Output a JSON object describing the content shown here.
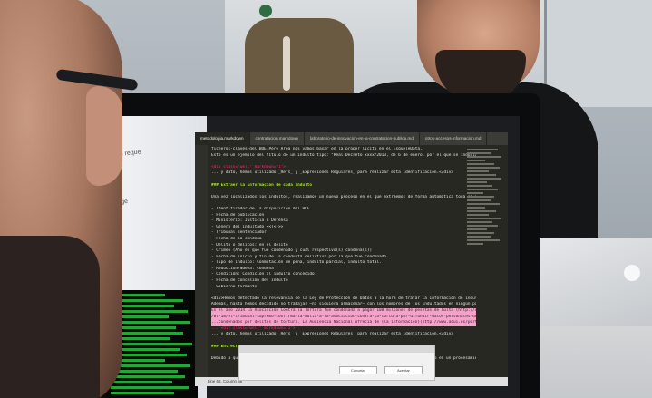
{
  "editor": {
    "tabs": [
      "metodologia.markdown",
      "contratacion.markdown",
      "laboratorio-de-innovacion-en-la-contratacion-publica.md",
      "otros-accesos-informacion.md"
    ],
    "active_tab_index": 0,
    "lines": [
      {
        "text": "ficheros-claves-del-BOE.Pero Area nos vamos basar en la proper licito en el EsqueleData.",
        "style": "n"
      },
      {
        "text": "Esto es un ejemplo del título de un indulto tipo: \"Real Decreto xxxx/2013, de 6 de enero, por el que se indulta a don NOMBRE ANAHI.\"",
        "style": "n"
      },
      {
        "text": "",
        "style": "n"
      },
      {
        "text": "<div class=\"well\" markdown=\"1\">",
        "style": "t"
      },
      {
        "text": "... y dato, hemos utilizado _Refs_ y _Expresiones Regulares_ para realizar esta identificación.</div>",
        "style": "n"
      },
      {
        "text": "",
        "style": "n"
      },
      {
        "text": "### Extraer la información de cada indulto",
        "style": "h"
      },
      {
        "text": "",
        "style": "n"
      },
      {
        "text": "Una vez localizados los indultos, realizamos un nuevo proceso en el que extraemos de forma automática toda la información relevante del indulto. De cada indulto extraemos los siguientes campos (en caso de que estén presentes):",
        "style": "n"
      },
      {
        "text": "",
        "style": "n"
      },
      {
        "text": "- Identificador de la disposición del BOE",
        "style": "n"
      },
      {
        "text": "- Fecha de publicación",
        "style": "n"
      },
      {
        "text": "- Ministerio: Justicia o Defensa",
        "style": "n"
      },
      {
        "text": "- Género del indultado <<{<}>>",
        "style": "n"
      },
      {
        "text": "- Tribunal sentenciador",
        "style": "n"
      },
      {
        "text": "- Fecha de la condena",
        "style": "n"
      },
      {
        "text": "- Delito o delitos: en el delito",
        "style": "n"
      },
      {
        "text": "- Crimen (Año en que fue condenado y cuál respectivo(s) condena(s))",
        "style": "n"
      },
      {
        "text": "- Fecha de inicio y fin de la conducta delictiva por la que fue condenado",
        "style": "n"
      },
      {
        "text": "- Tipo de indulto: Conmutación de pena, indulto parcial, indulto total.",
        "style": "n"
      },
      {
        "text": "- Reducción/Nueva: Condena",
        "style": "n"
      },
      {
        "text": "- Condición: Condición al indulto concedido",
        "style": "n"
      },
      {
        "text": "- Fecha de concesión del indulto",
        "style": "n"
      },
      {
        "text": "- Gobierno firmante",
        "style": "n"
      },
      {
        "text": "",
        "style": "n"
      },
      {
        "text": "<div>Hemos detectado la relevancia de la Ley de Protección de Datos a la hora de tratar la información de indultos.",
        "style": "n"
      },
      {
        "text": "Además, hasta hemos decidido no trabajar —ni siquiera almacenar— con los nombres de los indultados en ningún paso de nuestro proceso.",
        "style": "n"
      },
      {
        "text": "Es el año 2014 la Asociación Contra la Tortura fue condenada a pagar 100 millones de pesetas de multa (http://contrainfo.es/indu ...",
        "style": "sel"
      },
      {
        "text": "/07/18/el-tribunal-supremo-confirma-la-multa-a-la-asociacion-contra-la-tortura-por-difundir-datos-personales-de-poli",
        "style": "sel"
      },
      {
        "text": "...condenados por delitos de tortura. La Audiencia Nacional ofrecía de (la información)(http://www.aqui.es/portalweb/data ...",
        "style": "sel"
      },
      {
        "text": "... <div class=\"well\" markdown=\"1\">",
        "style": "t"
      },
      {
        "text": "... y dato, hemos utilizado _Refs_ y _Expresiones Regulares_ para realizar esta identificación.</div>",
        "style": "n"
      },
      {
        "text": "",
        "style": "n"
      },
      {
        "text": "### Entrecruzado de resultados",
        "style": "h"
      },
      {
        "text": "",
        "style": "n"
      },
      {
        "text": "Debido a que gran parte del trabajo realizado en los pasos 2 y 3 de la metodología está basado en un procesamiento complejo de",
        "style": "n"
      }
    ],
    "status": "Line 68, Column 58"
  },
  "background_window": {
    "labels": [
      "Pull reque",
      "stringe"
    ]
  },
  "dialog": {
    "buttons": [
      "Cancelar",
      "Aceptar"
    ]
  }
}
